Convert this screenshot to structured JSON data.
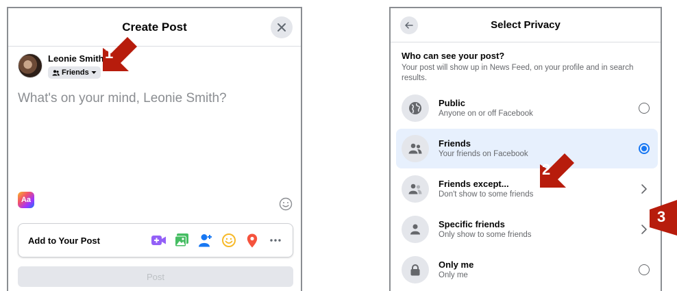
{
  "create_post": {
    "title": "Create Post",
    "user_name": "Leonie Smith",
    "audience_label": "Friends",
    "composer_placeholder": "What's on your mind, Leonie Smith?",
    "text_style_badge": "Aa",
    "add_to_post_label": "Add to Your Post",
    "add_icons": [
      "video-camera-icon",
      "photo-icon",
      "tag-people-icon",
      "feeling-icon",
      "location-pin-icon",
      "more-icon"
    ],
    "post_button_label": "Post"
  },
  "select_privacy": {
    "title": "Select Privacy",
    "question": "Who can see your post?",
    "description": "Your post will show up in News Feed, on your profile and in search results.",
    "options": [
      {
        "title": "Public",
        "subtitle": "Anyone on or off Facebook",
        "icon": "globe-icon",
        "control": "radio",
        "selected": false
      },
      {
        "title": "Friends",
        "subtitle": "Your friends on Facebook",
        "icon": "friends-icon",
        "control": "radio",
        "selected": true
      },
      {
        "title": "Friends except...",
        "subtitle": "Don't show to some friends",
        "icon": "friends-except-icon",
        "control": "chevron",
        "selected": false
      },
      {
        "title": "Specific friends",
        "subtitle": "Only show to some friends",
        "icon": "person-icon",
        "control": "chevron",
        "selected": false
      },
      {
        "title": "Only me",
        "subtitle": "Only me",
        "icon": "lock-icon",
        "control": "radio",
        "selected": false
      }
    ]
  },
  "step_markers": [
    {
      "label": "1"
    },
    {
      "label": "2"
    },
    {
      "label": "3"
    }
  ],
  "colors": {
    "accent": "#1877f2",
    "marker": "#b71c0c",
    "selected_row": "#e7f0fd"
  }
}
